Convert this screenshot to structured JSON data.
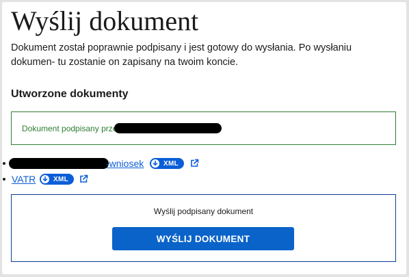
{
  "page": {
    "title": "Wyślij dokument",
    "description": "Dokument został poprawnie podpisany i jest gotowy do wysłania. Po wysłaniu dokumen- tu zostanie on zapisany na twoim koncie."
  },
  "documents_section": {
    "heading": "Utworzone dokumenty",
    "signed_status": "Dokument podpisany przez",
    "items": [
      {
        "link_text": "-wniosek",
        "badge": "XML",
        "icon": "external-link-icon"
      },
      {
        "link_text": "VATR",
        "badge": "XML",
        "icon": "external-link-icon"
      }
    ]
  },
  "send_section": {
    "label": "Wyślij podpisany dokument",
    "button_label": "WYŚLIJ DOKUMENT"
  },
  "colors": {
    "success": "#2e7d32",
    "primary": "#0a63c9",
    "link": "#0b5ed7",
    "border_dark": "#0b3d91"
  }
}
